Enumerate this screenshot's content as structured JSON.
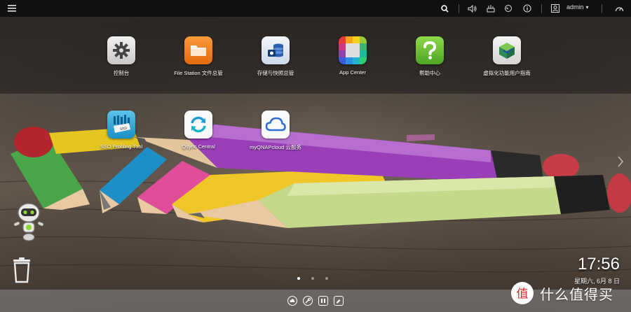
{
  "colors": {
    "topbar": "#101010",
    "dock": "#8c8c8c",
    "settings": "#d9d9d9",
    "filestation": "#f07820",
    "storage": "#2a5fb0",
    "help": "#6cc033",
    "virtual": "#2e8b57",
    "ssd": "#1aa4d8",
    "qsync": "#1e9bd7",
    "myqnap": "#2f6fd6"
  },
  "topbar": {
    "icons": [
      "menu-icon",
      "search-icon",
      "volume-icon",
      "tasks-icon",
      "sync-icon",
      "info-icon",
      "user-icon",
      "dashboard-icon"
    ],
    "user": "admin",
    "caret": "▾"
  },
  "apps": [
    {
      "label": "控制台",
      "icon": "gear-icon"
    },
    {
      "label": "File Station 文件总管",
      "icon": "folder-icon"
    },
    {
      "label": "存储与快照总管",
      "icon": "storage-icon"
    },
    {
      "label": "App Center",
      "icon": "grid-icon"
    },
    {
      "label": "帮助中心",
      "icon": "question-icon"
    },
    {
      "label": "虚拟化功能用户指南",
      "icon": "cube-icon"
    },
    {
      "label": "SSD Profiling Tool",
      "icon": "ssd-icon"
    },
    {
      "label": "Qsync Central",
      "icon": "sync-arrows-icon"
    },
    {
      "label": "myQNAPcloud 云服务",
      "icon": "cloud-icon"
    }
  ],
  "clock": {
    "time": "17:56",
    "date": "星期六, 6月 8 日"
  },
  "pager": {
    "pages": 3,
    "active": 1
  },
  "watermark": {
    "text": "什么值得买",
    "logo": "值"
  }
}
